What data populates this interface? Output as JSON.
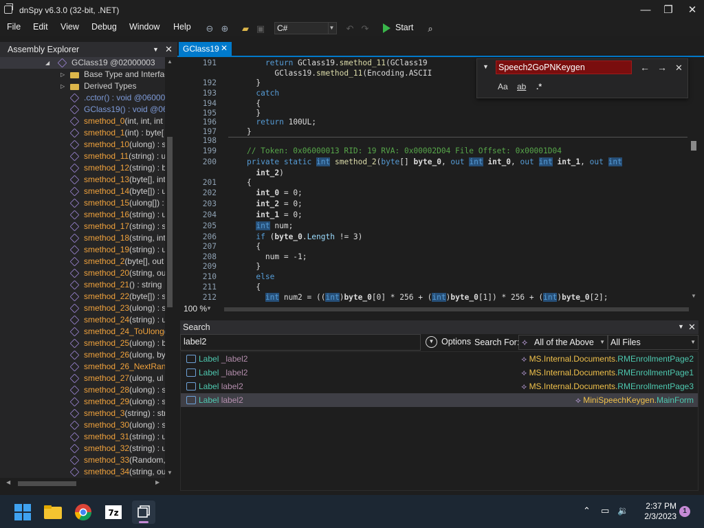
{
  "window": {
    "title": "dnSpy v6.3.0 (32-bit, .NET)",
    "minimize": "—",
    "maximize": "❐",
    "close": "✕"
  },
  "menu": [
    "File",
    "Edit",
    "View",
    "Debug",
    "Window",
    "Help"
  ],
  "toolbar": {
    "language": "C#",
    "start_label": "Start"
  },
  "assembly_explorer": {
    "title": "Assembly Explorer",
    "items": [
      {
        "kind": "class",
        "name": "GClass19 @02000003",
        "sig": ""
      },
      {
        "kind": "folder",
        "name": "Base Type and Interfac",
        "sig": ""
      },
      {
        "kind": "folder",
        "name": "Derived Types",
        "sig": ""
      },
      {
        "kind": "ctor",
        "name": ".cctor()",
        "sig": " : void @06000"
      },
      {
        "kind": "ctor",
        "name": "GClass19()",
        "sig": " : void @060"
      },
      {
        "kind": "method",
        "name": "smethod_0",
        "sig": "(int, int, int"
      },
      {
        "kind": "method",
        "name": "smethod_1",
        "sig": "(int) : byte["
      },
      {
        "kind": "method",
        "name": "smethod_10",
        "sig": "(ulong) : s"
      },
      {
        "kind": "method",
        "name": "smethod_11",
        "sig": "(string) : u"
      },
      {
        "kind": "method",
        "name": "smethod_12",
        "sig": "(string) : b"
      },
      {
        "kind": "method",
        "name": "smethod_13",
        "sig": "(byte[], int"
      },
      {
        "kind": "method",
        "name": "smethod_14",
        "sig": "(byte[]) : u"
      },
      {
        "kind": "method",
        "name": "smethod_15",
        "sig": "(ulong[]) :"
      },
      {
        "kind": "method",
        "name": "smethod_16",
        "sig": "(string) : u"
      },
      {
        "kind": "method",
        "name": "smethod_17",
        "sig": "(string) : s"
      },
      {
        "kind": "method",
        "name": "smethod_18",
        "sig": "(string, int"
      },
      {
        "kind": "method",
        "name": "smethod_19",
        "sig": "(string) : u"
      },
      {
        "kind": "method",
        "name": "smethod_2",
        "sig": "(byte[], out"
      },
      {
        "kind": "method",
        "name": "smethod_20",
        "sig": "(string, ou"
      },
      {
        "kind": "method",
        "name": "smethod_21",
        "sig": "() : string"
      },
      {
        "kind": "method",
        "name": "smethod_22",
        "sig": "(byte[]) : s"
      },
      {
        "kind": "method",
        "name": "smethod_23",
        "sig": "(ulong) : s"
      },
      {
        "kind": "method",
        "name": "smethod_24",
        "sig": "(string) : u"
      },
      {
        "kind": "method",
        "name": "smethod_24_ToUlong",
        "sig": "("
      },
      {
        "kind": "method",
        "name": "smethod_25",
        "sig": "(ulong) : b"
      },
      {
        "kind": "method",
        "name": "smethod_26",
        "sig": "(ulong, by"
      },
      {
        "kind": "method",
        "name": "smethod_26_NextRan",
        "sig": ""
      },
      {
        "kind": "method",
        "name": "smethod_27",
        "sig": "(ulong, ul"
      },
      {
        "kind": "method",
        "name": "smethod_28",
        "sig": "(ulong) : s"
      },
      {
        "kind": "method",
        "name": "smethod_29",
        "sig": "(ulong) : s"
      },
      {
        "kind": "method",
        "name": "smethod_3",
        "sig": "(string) : str"
      },
      {
        "kind": "method",
        "name": "smethod_30",
        "sig": "(ulong) : s"
      },
      {
        "kind": "method",
        "name": "smethod_31",
        "sig": "(string) : u"
      },
      {
        "kind": "method",
        "name": "smethod_32",
        "sig": "(string) : u"
      },
      {
        "kind": "method",
        "name": "smethod_33",
        "sig": "(Random,"
      },
      {
        "kind": "method",
        "name": "smethod_34",
        "sig": "(string, ou"
      }
    ]
  },
  "editor": {
    "tab_label": "GClass19",
    "zoom": "100 %",
    "lines": [
      {
        "n": "191",
        "html": "        <span class='kw'>return</span> GClass19.<span class='fn'>smethod_11</span>(GClass19"
      },
      {
        "n": "",
        "html": "          GClass19.<span class='fn'>smethod_11</span>(Encoding.ASCII"
      },
      {
        "n": "192",
        "html": "      }"
      },
      {
        "n": "193",
        "html": "      <span class='kw'>catch</span>"
      },
      {
        "n": "194",
        "html": "      {"
      },
      {
        "n": "195",
        "html": "      }"
      },
      {
        "n": "196",
        "html": "      <span class='kw'>return</span> 100UL;"
      },
      {
        "n": "197",
        "html": "    }"
      },
      {
        "n": "198",
        "html": ""
      },
      {
        "n": "199",
        "html": "    <span class='cm'>// Token: 0x06000013 RID: 19 RVA: 0x00002D04 File Offset: 0x00001D04</span>"
      },
      {
        "n": "200",
        "html": "    <span class='kw'>private static</span> <span class='kwb'>int</span> <span class='fn'>smethod_2</span>(<span class='kw'>byte</span>[] <b>byte_0</b>, <span class='kw'>out</span> <span class='kwb'>int</span> <b>int_0</b>, <span class='kw'>out</span> <span class='kwb'>int</span> <b>int_1</b>, <span class='kw'>out</span> <span class='kwb'>int</span>"
      },
      {
        "n": "",
        "html": "      <b>int_2</b>)"
      },
      {
        "n": "201",
        "html": "    {"
      },
      {
        "n": "202",
        "html": "      <b>int_0</b> = 0;"
      },
      {
        "n": "203",
        "html": "      <b>int_2</b> = 0;"
      },
      {
        "n": "204",
        "html": "      <b>int_1</b> = 0;"
      },
      {
        "n": "205",
        "html": "      <span class='kwb'>int</span> num;"
      },
      {
        "n": "206",
        "html": "      <span class='kw'>if</span> (<b>byte_0</b>.<span class='gy'>Length</span> != 3)"
      },
      {
        "n": "207",
        "html": "      {"
      },
      {
        "n": "208",
        "html": "        num = -1;"
      },
      {
        "n": "209",
        "html": "      }"
      },
      {
        "n": "210",
        "html": "      <span class='kw'>else</span>"
      },
      {
        "n": "211",
        "html": "      {"
      },
      {
        "n": "212",
        "html": "        <span class='kwb'>int</span> num2 = ((<span class='kwb'>int</span>)<b>byte_0</b>[0] * 256 + (<span class='kwb'>int</span>)<b>byte_0</b>[1]) * 256 + (<span class='kwb'>int</span>)<b>byte_0</b>[2];"
      }
    ]
  },
  "find": {
    "value": "Speech2GoPNKeygen",
    "opt_case": "Aa",
    "opt_word": "ab",
    "opt_regex": ".*"
  },
  "search": {
    "title": "Search",
    "query": "label2",
    "options_label": "Options",
    "search_for_label": "Search For:",
    "search_for_value": "All of the Above",
    "files_value": "All Files",
    "results": [
      {
        "type": "Label",
        "name": "_label2",
        "ns": "MS.Internal.Documents.",
        "cls": "RMEnrollmentPage2",
        "selected": false
      },
      {
        "type": "Label",
        "name": "_label2",
        "ns": "MS.Internal.Documents.",
        "cls": "RMEnrollmentPage1",
        "selected": false
      },
      {
        "type": "Label",
        "name": "label2",
        "ns": "MS.Internal.Documents.",
        "cls": "RMEnrollmentPage3",
        "selected": false
      },
      {
        "type": "Label",
        "name": "label2",
        "ns": "MiniSpeechKeygen.",
        "cls": "MainForm",
        "selected": true
      }
    ]
  },
  "taskbar": {
    "time": "2:37 PM",
    "date": "2/3/2023",
    "badge": "1"
  },
  "colors": {
    "accent": "#007acc",
    "method": "#f0a23c",
    "find_bg": "#7a0e0e"
  }
}
